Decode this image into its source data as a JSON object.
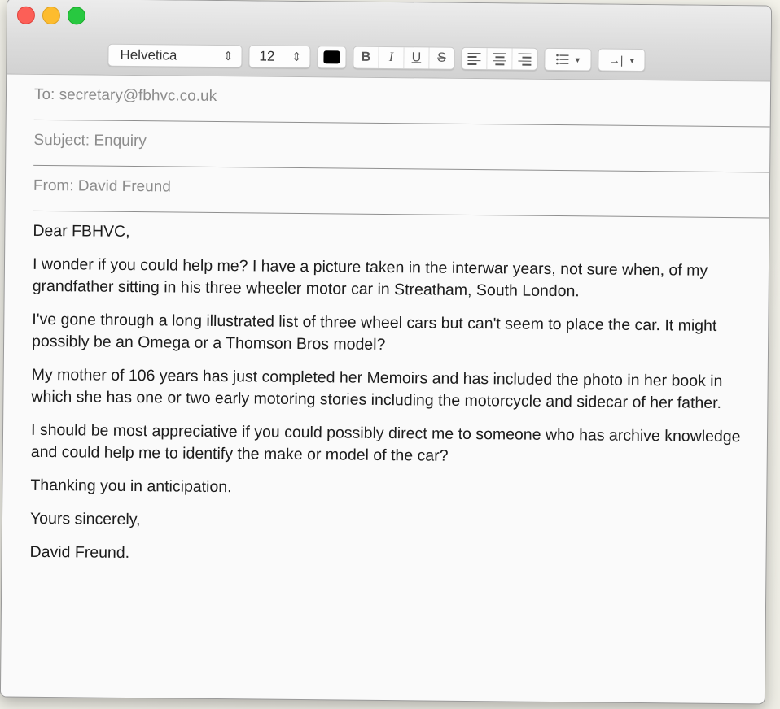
{
  "window": {
    "traffic_lights": [
      "close",
      "minimize",
      "zoom"
    ],
    "colors": {
      "close": "#fc5f57",
      "minimize": "#fdbc2e",
      "zoom": "#28c840"
    }
  },
  "toolbar": {
    "font_family": "Helvetica",
    "font_size": "12",
    "text_color": "#000000",
    "style_buttons": [
      "B",
      "I",
      "U",
      "S"
    ],
    "alignment_icons": [
      "align-left-icon",
      "align-center-icon",
      "align-right-icon"
    ],
    "list_icon": "list-bullets-icon",
    "indent_icon": "indent-icon",
    "indent_label": "→|"
  },
  "header": {
    "to": "To: secretary@fbhvc.co.uk",
    "subject": "Subject: Enquiry",
    "from": "From: David Freund"
  },
  "body": {
    "paragraphs": [
      "Dear FBHVC,",
      "I wonder if you could help me? I have a picture taken in the interwar years, not sure when, of my grandfather sitting in his three wheeler motor car in Streatham, South London.",
      "I've gone through a long illustrated list of three wheel cars but can't seem to place the car. It might possibly be an Omega or a Thomson Bros model?",
      "My mother of 106 years has just completed her Memoirs and has included the photo in her book in which she has one or two early motoring stories including the motorcycle and sidecar of her father.",
      "I should be most appreciative if you could possibly direct me to someone who has archive knowledge and could help me to identify the make or model of the car?",
      "Thanking you in anticipation.",
      "Yours sincerely,",
      "David Freund."
    ]
  }
}
